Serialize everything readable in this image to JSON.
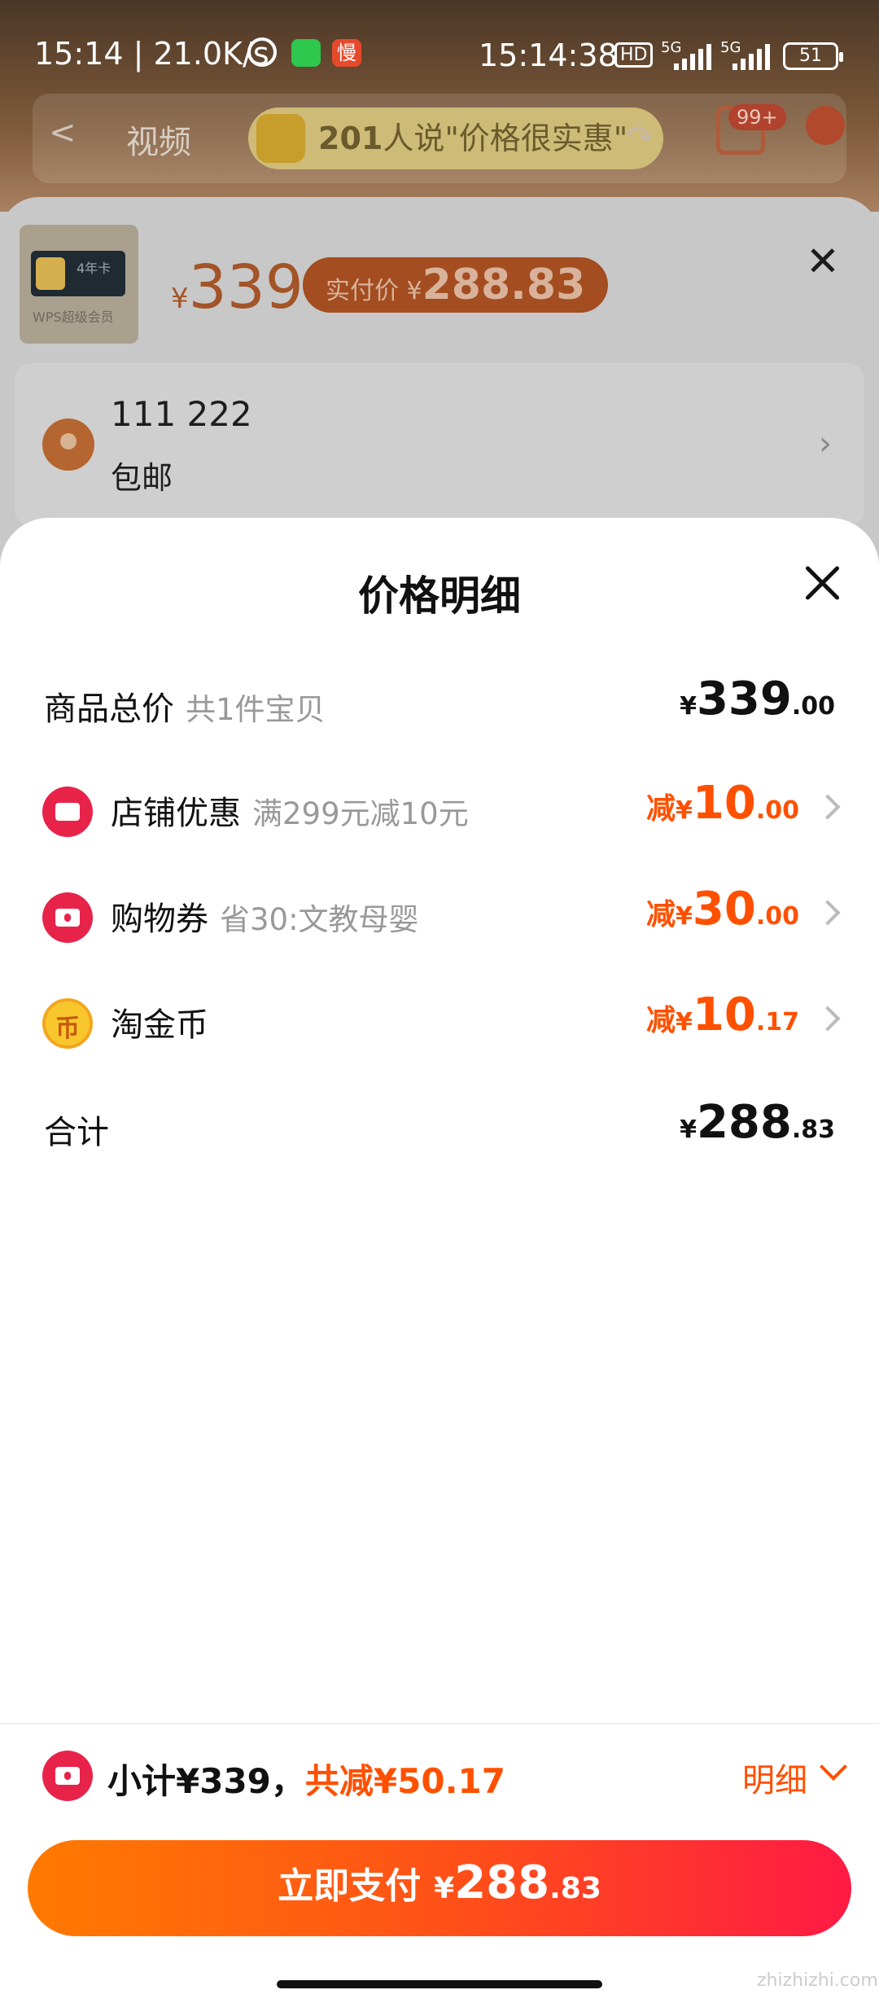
{
  "status_bar": {
    "time_left": "15:14",
    "net_speed": "21.0K/s",
    "app_badge": "慢",
    "time_center": "15:14:38",
    "hd": "HD",
    "sim1": "5G",
    "sim2": "5G",
    "battery": "51"
  },
  "background_page": {
    "back_glyph": "<",
    "tab_label": "视频",
    "praise_count": "201",
    "praise_text": "人说\"价格很实惠\"",
    "cart_badge": "99+",
    "product_thumb_text": "4年卡",
    "product_thumb_caption": "WPS超级会员",
    "price_yen": "¥",
    "price": "339",
    "real_price_label": "实付价 ¥",
    "real_price": "288.83",
    "address_name": "111 222",
    "shipping": "包邮"
  },
  "sheet": {
    "title": "价格明细",
    "rows": [
      {
        "label": "商品总价",
        "sub": "共1件宝贝",
        "prefix": "",
        "yen": "¥",
        "int": "339",
        "dec": ".00"
      },
      {
        "label": "店铺优惠",
        "sub": "满299元减10元",
        "prefix": "减",
        "yen": "¥",
        "int": "10",
        "dec": ".00"
      },
      {
        "label": "购物券",
        "sub": "省30:文教母婴",
        "prefix": "减",
        "yen": "¥",
        "int": "30",
        "dec": ".00"
      },
      {
        "label": "淘金币",
        "sub": "",
        "prefix": "减",
        "yen": "¥",
        "int": "10",
        "dec": ".17"
      },
      {
        "label": "合计",
        "sub": "",
        "prefix": "",
        "yen": "¥",
        "int": "288",
        "dec": ".83"
      }
    ],
    "coin_glyph": "币"
  },
  "bottom_bar": {
    "subtotal": "小计¥339，",
    "total_discount": "共减¥50.17",
    "detail_label": "明细",
    "pay_label": "立即支付",
    "pay_yen": "¥",
    "pay_int": "288",
    "pay_dec": ".83"
  },
  "colors": {
    "accent": "#ff5000",
    "icon_red": "#e8234a",
    "coin_gold": "#f8c72e"
  },
  "watermark": "zhizhizhi.com"
}
